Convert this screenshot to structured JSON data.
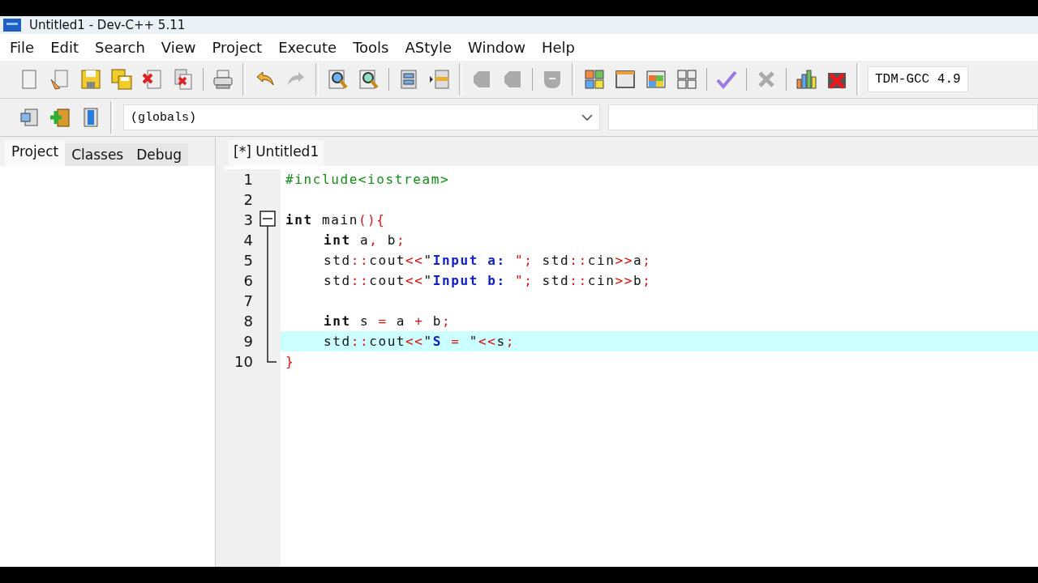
{
  "window": {
    "title": "Untitled1 - Dev-C++ 5.11"
  },
  "menu": [
    "File",
    "Edit",
    "Search",
    "View",
    "Project",
    "Execute",
    "Tools",
    "AStyle",
    "Window",
    "Help"
  ],
  "compiler": {
    "value": "TDM-GCC 4.9"
  },
  "scope_combo": {
    "value": "(globals)"
  },
  "panel_tabs": [
    {
      "label": "Project",
      "selected": true
    },
    {
      "label": "Classes",
      "selected": false
    },
    {
      "label": "Debug",
      "selected": false
    }
  ],
  "editor_tabs": [
    {
      "label": "[*] Untitled1",
      "selected": true
    }
  ],
  "lines": [
    {
      "number": "1",
      "kind": "plain",
      "highlighted": false,
      "tokens": [
        {
          "kind": "pre",
          "text": "#include<iostream>"
        }
      ]
    },
    {
      "number": "2",
      "kind": "plain",
      "highlighted": false
    },
    {
      "number": "3",
      "kind": "foldstart",
      "highlighted": false,
      "tokens": [
        {
          "kind": "kw",
          "text": "int"
        },
        {
          "kind": "plain",
          "text": " main"
        },
        {
          "kind": "sym",
          "text": "(){"
        }
      ],
      "children": [
        {
          "number": "4",
          "highlighted": false,
          "tokens": [
            {
              "kind": "kw",
              "text": "int"
            },
            {
              "kind": "plain",
              "text": " a"
            },
            {
              "kind": "sym",
              "text": ","
            },
            {
              "kind": "plain",
              "text": " b"
            },
            {
              "kind": "sym",
              "text": ";"
            }
          ]
        },
        {
          "number": "5",
          "highlighted": false,
          "tokens": [
            {
              "kind": "plain",
              "text": "std"
            },
            {
              "kind": "sym",
              "text": "::"
            },
            {
              "kind": "plain",
              "text": "cout"
            },
            {
              "kind": "sym",
              "text": "<<"
            },
            {
              "kind": "plain",
              "text": "\""
            },
            {
              "kind": "str",
              "text": "Input a: "
            },
            {
              "kind": "sym",
              "text": "\";"
            },
            {
              "kind": "plain",
              "text": " std"
            },
            {
              "kind": "sym",
              "text": "::"
            },
            {
              "kind": "plain",
              "text": "cin"
            },
            {
              "kind": "sym",
              "text": ">>"
            },
            {
              "kind": "plain",
              "text": "a"
            },
            {
              "kind": "sym",
              "text": ";"
            }
          ]
        },
        {
          "number": "6",
          "highlighted": false,
          "tokens": [
            {
              "kind": "plain",
              "text": "std"
            },
            {
              "kind": "sym",
              "text": "::"
            },
            {
              "kind": "plain",
              "text": "cout"
            },
            {
              "kind": "sym",
              "text": "<<"
            },
            {
              "kind": "plain",
              "text": "\""
            },
            {
              "kind": "str",
              "text": "Input b: "
            },
            {
              "kind": "sym",
              "text": "\";"
            },
            {
              "kind": "plain",
              "text": " std"
            },
            {
              "kind": "sym",
              "text": "::"
            },
            {
              "kind": "plain",
              "text": "cin"
            },
            {
              "kind": "sym",
              "text": ">>"
            },
            {
              "kind": "plain",
              "text": "b"
            },
            {
              "kind": "sym",
              "text": ";"
            }
          ]
        },
        {
          "number": "7",
          "highlighted": false
        },
        {
          "number": "8",
          "highlighted": false,
          "tokens": [
            {
              "kind": "kw",
              "text": "int"
            },
            {
              "kind": "plain",
              "text": " s "
            },
            {
              "kind": "sym",
              "text": "="
            },
            {
              "kind": "plain",
              "text": " a "
            },
            {
              "kind": "sym",
              "text": "+"
            },
            {
              "kind": "plain",
              "text": " b"
            },
            {
              "kind": "sym",
              "text": ";"
            }
          ]
        },
        {
          "number": "9",
          "highlighted": true,
          "tokens": [
            {
              "kind": "plain",
              "text": "std"
            },
            {
              "kind": "sym",
              "text": "::"
            },
            {
              "kind": "plain",
              "text": "cout"
            },
            {
              "kind": "sym",
              "text": "<<"
            },
            {
              "kind": "plain",
              "text": "\""
            },
            {
              "kind": "str",
              "text": "S "
            },
            {
              "kind": "sym",
              "text": "="
            },
            {
              "kind": "plain",
              "text": " \""
            },
            {
              "kind": "sym",
              "text": "<<"
            },
            {
              "kind": "plain",
              "text": "s"
            },
            {
              "kind": "sym",
              "text": ";"
            }
          ]
        }
      ]
    },
    {
      "number": "10",
      "kind": "foldend",
      "highlighted": false,
      "tokens": [
        {
          "kind": "sym",
          "text": "}"
        }
      ]
    }
  ]
}
